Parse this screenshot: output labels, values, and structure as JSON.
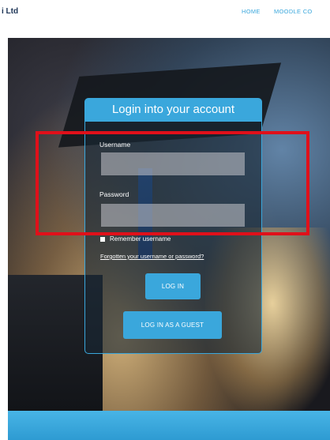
{
  "header": {
    "brand": "i Ltd",
    "nav": {
      "home": "HOME",
      "moodle": "MOODLE CO"
    }
  },
  "login": {
    "title": "Login into your account",
    "username_label": "Username",
    "username_value": "",
    "password_label": "Password",
    "password_value": "",
    "remember_label": "Remember username",
    "forgot_link": "Forgotten your username or password?",
    "login_button": "LOG IN",
    "guest_button": "LOG IN AS A GUEST"
  },
  "colors": {
    "accent": "#3aa7dc",
    "highlight": "#e0101a",
    "brand_text": "#1d3557"
  }
}
